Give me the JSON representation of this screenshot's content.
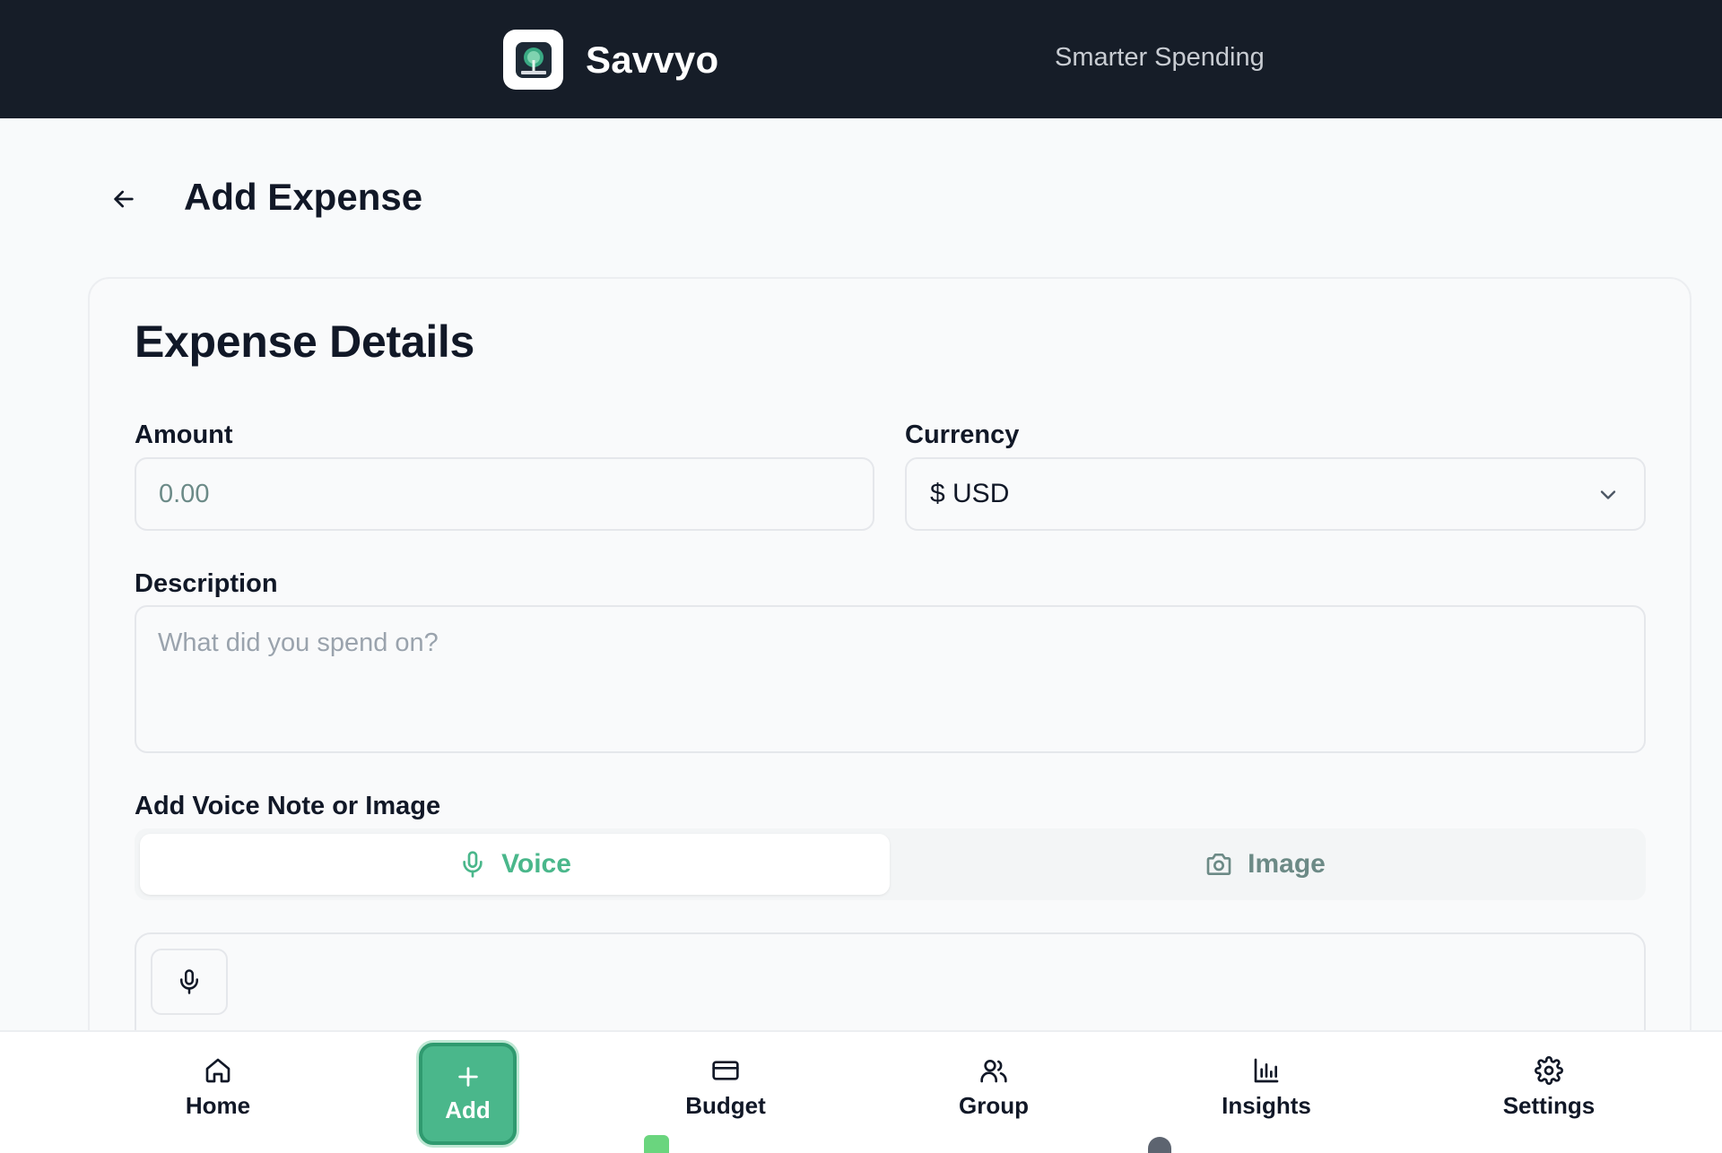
{
  "header": {
    "app_name": "Savvyo",
    "tagline": "Smarter Spending",
    "logo_icon": "tree-logo-icon"
  },
  "page": {
    "title": "Add Expense",
    "back_icon": "arrow-left-icon"
  },
  "form": {
    "card_title": "Expense Details",
    "amount": {
      "label": "Amount",
      "placeholder": "0.00",
      "value": ""
    },
    "currency": {
      "label": "Currency",
      "selected": "$ USD",
      "icon": "chevron-down-icon"
    },
    "description": {
      "label": "Description",
      "placeholder": "What did you spend on?",
      "value": ""
    },
    "attachments": {
      "label": "Add Voice Note or Image",
      "tabs": [
        {
          "label": "Voice",
          "icon": "microphone-icon",
          "active": true
        },
        {
          "label": "Image",
          "icon": "camera-icon",
          "active": false
        }
      ],
      "record_icon": "microphone-icon"
    }
  },
  "bottom_nav": {
    "items": [
      {
        "label": "Home",
        "icon": "home-icon"
      },
      {
        "label": "Add",
        "icon": "plus-icon",
        "active": true
      },
      {
        "label": "Budget",
        "icon": "credit-card-icon"
      },
      {
        "label": "Group",
        "icon": "users-icon"
      },
      {
        "label": "Insights",
        "icon": "bar-chart-icon"
      },
      {
        "label": "Settings",
        "icon": "gear-icon"
      }
    ]
  },
  "colors": {
    "header_bg": "#161d28",
    "accent_green": "#4ab78b",
    "accent_green_dark": "#2f9a6f",
    "muted_teal": "#6c8a86",
    "page_bg": "#f8fafb"
  }
}
